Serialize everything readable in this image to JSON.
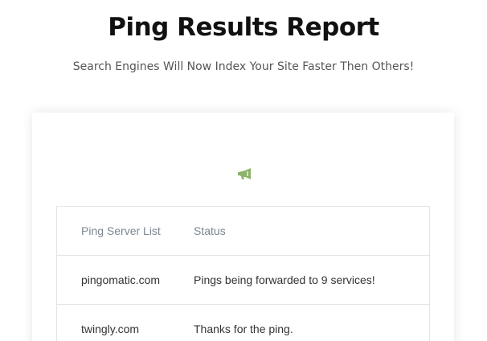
{
  "header": {
    "title": "Ping Results Report",
    "subtitle": "Search Engines Will Now Index Your Site Faster Then Others!"
  },
  "card": {
    "icon": "megaphone-icon",
    "accent_color": "#8db36a",
    "table": {
      "columns": [
        "Ping Server List",
        "Status"
      ],
      "rows": [
        {
          "server": "pingomatic.com",
          "status": "Pings being forwarded to 9 services!"
        },
        {
          "server": "twingly.com",
          "status": "Thanks for the ping."
        }
      ]
    }
  }
}
